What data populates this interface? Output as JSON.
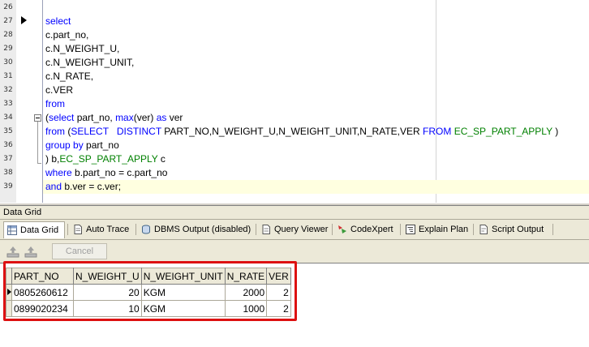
{
  "editor": {
    "lines": [
      {
        "num": "26",
        "tokens": []
      },
      {
        "num": "27",
        "tokens": [
          {
            "t": "select",
            "c": "kw"
          }
        ]
      },
      {
        "num": "28",
        "tokens": [
          {
            "t": "c.part_no,",
            "c": ""
          }
        ]
      },
      {
        "num": "29",
        "tokens": [
          {
            "t": "c.N_WEIGHT_U,",
            "c": ""
          }
        ]
      },
      {
        "num": "30",
        "tokens": [
          {
            "t": "c.N_WEIGHT_UNIT,",
            "c": ""
          }
        ]
      },
      {
        "num": "31",
        "tokens": [
          {
            "t": "c.N_RATE,",
            "c": ""
          }
        ]
      },
      {
        "num": "32",
        "tokens": [
          {
            "t": "c.VER",
            "c": ""
          }
        ]
      },
      {
        "num": "33",
        "tokens": [
          {
            "t": "from",
            "c": "kw"
          }
        ]
      },
      {
        "num": "34",
        "tokens": [
          {
            "t": "(",
            "c": ""
          },
          {
            "t": "select",
            "c": "kw"
          },
          {
            "t": " part_no, ",
            "c": ""
          },
          {
            "t": "max",
            "c": "kw"
          },
          {
            "t": "(ver) ",
            "c": ""
          },
          {
            "t": "as",
            "c": "kw"
          },
          {
            "t": " ver",
            "c": ""
          }
        ]
      },
      {
        "num": "35",
        "tokens": [
          {
            "t": "from",
            "c": "kw"
          },
          {
            "t": " (",
            "c": ""
          },
          {
            "t": "SELECT",
            "c": "kw"
          },
          {
            "t": "   ",
            "c": ""
          },
          {
            "t": "DISTINCT",
            "c": "kw"
          },
          {
            "t": " PART_NO,N_WEIGHT_U,N_WEIGHT_UNIT,N_RATE,VER ",
            "c": ""
          },
          {
            "t": "FROM",
            "c": "kw"
          },
          {
            "t": " ",
            "c": ""
          },
          {
            "t": "EC_SP_PART_APPLY",
            "c": "tbl"
          },
          {
            "t": " )",
            "c": ""
          }
        ]
      },
      {
        "num": "36",
        "tokens": [
          {
            "t": "group by",
            "c": "kw"
          },
          {
            "t": " part_no",
            "c": ""
          }
        ]
      },
      {
        "num": "37",
        "tokens": [
          {
            "t": ") b,",
            "c": ""
          },
          {
            "t": "EC_SP_PART_APPLY",
            "c": "tbl"
          },
          {
            "t": " c",
            "c": ""
          }
        ]
      },
      {
        "num": "38",
        "tokens": [
          {
            "t": "where",
            "c": "kw"
          },
          {
            "t": " b.part_no = c.part_no",
            "c": ""
          }
        ]
      },
      {
        "num": "39",
        "tokens": [
          {
            "t": "and",
            "c": "kw"
          },
          {
            "t": " b.ver = c.ver;",
            "c": ""
          }
        ]
      }
    ]
  },
  "panel": {
    "title": "Data Grid"
  },
  "tabs": [
    {
      "label": "Data Grid",
      "icon": "grid-icon",
      "active": true
    },
    {
      "label": "Auto Trace",
      "icon": "document-icon",
      "active": false
    },
    {
      "label": "DBMS Output (disabled)",
      "icon": "dbms-output-icon",
      "active": false
    },
    {
      "label": "Query Viewer",
      "icon": "query-viewer-icon",
      "active": false
    },
    {
      "label": "CodeXpert",
      "icon": "codexpert-icon",
      "active": false
    },
    {
      "label": "Explain Plan",
      "icon": "explain-plan-icon",
      "active": false
    },
    {
      "label": "Script Output",
      "icon": "script-output-icon",
      "active": false
    }
  ],
  "toolbar": {
    "cancel_label": "Cancel",
    "icons": [
      "export-icon",
      "import-icon"
    ]
  },
  "grid": {
    "columns": [
      "PART_NO",
      "N_WEIGHT_U",
      "N_WEIGHT_UNIT",
      "N_RATE",
      "VER"
    ],
    "rows": [
      [
        "0805260612",
        "20",
        "KGM",
        "2000",
        "2"
      ],
      [
        "0899020234",
        "10",
        "KGM",
        "1000",
        "2"
      ]
    ]
  },
  "colors": {
    "keyword": "#0000ff",
    "table": "#008000",
    "highlight": "#dd1111"
  }
}
